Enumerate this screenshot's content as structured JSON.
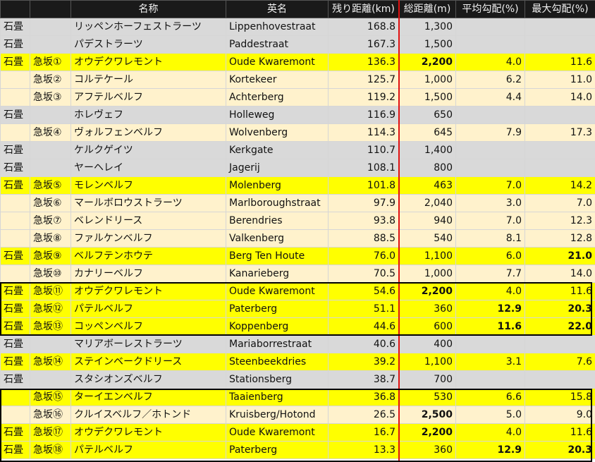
{
  "header": [
    "",
    "",
    "名称",
    "英名",
    "残り距離(km)",
    "総距離(m)",
    "平均勾配(%)",
    "最大勾配(%)"
  ],
  "rows": [
    {
      "type": "石畳",
      "climb": "",
      "name": "リッペンホーフェストラーツ",
      "en": "Lippenhovestraat",
      "km": "168.8",
      "total": "1,300",
      "avg": "",
      "max": "",
      "style": "gray",
      "bold": []
    },
    {
      "type": "石畳",
      "climb": "",
      "name": "パデストラーツ",
      "en": "Paddestraat",
      "km": "167.3",
      "total": "1,500",
      "avg": "",
      "max": "",
      "style": "gray",
      "bold": []
    },
    {
      "type": "石畳",
      "climb": "急坂①",
      "name": "オウデクワレモント",
      "en": "Oude Kwaremont",
      "km": "136.3",
      "total": "2,200",
      "avg": "4.0",
      "max": "11.6",
      "style": "yellow",
      "bold": [
        "total"
      ]
    },
    {
      "type": "",
      "climb": "急坂②",
      "name": "コルテケール",
      "en": "Kortekeer",
      "km": "125.7",
      "total": "1,000",
      "avg": "6.2",
      "max": "11.0",
      "style": "cream",
      "bold": []
    },
    {
      "type": "",
      "climb": "急坂③",
      "name": "アフテルベルフ",
      "en": "Achterberg",
      "km": "119.2",
      "total": "1,500",
      "avg": "4.4",
      "max": "14.0",
      "style": "cream",
      "bold": []
    },
    {
      "type": "石畳",
      "climb": "",
      "name": "ホレヴェフ",
      "en": "Holleweg",
      "km": "116.9",
      "total": "650",
      "avg": "",
      "max": "",
      "style": "gray",
      "bold": []
    },
    {
      "type": "",
      "climb": "急坂④",
      "name": "ヴォルフェンベルフ",
      "en": "Wolvenberg",
      "km": "114.3",
      "total": "645",
      "avg": "7.9",
      "max": "17.3",
      "style": "cream",
      "bold": []
    },
    {
      "type": "石畳",
      "climb": "",
      "name": "ケルクゲイツ",
      "en": "Kerkgate",
      "km": "110.7",
      "total": "1,400",
      "avg": "",
      "max": "",
      "style": "gray",
      "bold": []
    },
    {
      "type": "石畳",
      "climb": "",
      "name": "ヤーヘレイ",
      "en": "Jagerij",
      "km": "108.1",
      "total": "800",
      "avg": "",
      "max": "",
      "style": "gray",
      "bold": []
    },
    {
      "type": "石畳",
      "climb": "急坂⑤",
      "name": "モレンベルフ",
      "en": "Molenberg",
      "km": "101.8",
      "total": "463",
      "avg": "7.0",
      "max": "14.2",
      "style": "yellow",
      "bold": []
    },
    {
      "type": "",
      "climb": "急坂⑥",
      "name": "マールボロウストラーツ",
      "en": "Marlboroughstraat",
      "km": "97.9",
      "total": "2,040",
      "avg": "3.0",
      "max": "7.0",
      "style": "cream",
      "bold": []
    },
    {
      "type": "",
      "climb": "急坂⑦",
      "name": "ベレンドリース",
      "en": "Berendries",
      "km": "93.8",
      "total": "940",
      "avg": "7.0",
      "max": "12.3",
      "style": "cream",
      "bold": []
    },
    {
      "type": "",
      "climb": "急坂⑧",
      "name": "ファルケンベルフ",
      "en": "Valkenberg",
      "km": "88.5",
      "total": "540",
      "avg": "8.1",
      "max": "12.8",
      "style": "cream",
      "bold": []
    },
    {
      "type": "石畳",
      "climb": "急坂⑨",
      "name": "ベルフテンホウテ",
      "en": "Berg Ten Houte",
      "km": "76.0",
      "total": "1,100",
      "avg": "6.0",
      "max": "21.0",
      "style": "yellow",
      "bold": [
        "max"
      ]
    },
    {
      "type": "",
      "climb": "急坂⑩",
      "name": "カナリーベルフ",
      "en": "Kanarieberg",
      "km": "70.5",
      "total": "1,000",
      "avg": "7.7",
      "max": "14.0",
      "style": "cream",
      "bold": []
    },
    {
      "type": "石畳",
      "climb": "急坂⑪",
      "name": "オウデクワレモント",
      "en": "Oude Kwaremont",
      "km": "54.6",
      "total": "2,200",
      "avg": "4.0",
      "max": "11.6",
      "style": "yellow",
      "bold": [
        "total"
      ]
    },
    {
      "type": "石畳",
      "climb": "急坂⑫",
      "name": "パテルベルフ",
      "en": "Paterberg",
      "km": "51.1",
      "total": "360",
      "avg": "12.9",
      "max": "20.3",
      "style": "yellow",
      "bold": [
        "avg",
        "max"
      ]
    },
    {
      "type": "石畳",
      "climb": "急坂⑬",
      "name": "コッペンベルフ",
      "en": "Koppenberg",
      "km": "44.6",
      "total": "600",
      "avg": "11.6",
      "max": "22.0",
      "style": "yellow",
      "bold": [
        "avg",
        "max"
      ]
    },
    {
      "type": "石畳",
      "climb": "",
      "name": "マリアボーレストラーツ",
      "en": "Mariaborrestraat",
      "km": "40.6",
      "total": "400",
      "avg": "",
      "max": "",
      "style": "gray",
      "bold": []
    },
    {
      "type": "石畳",
      "climb": "急坂⑭",
      "name": "ステインベークドリース",
      "en": "Steenbeekdries",
      "km": "39.2",
      "total": "1,100",
      "avg": "3.1",
      "max": "7.6",
      "style": "yellow",
      "bold": []
    },
    {
      "type": "石畳",
      "climb": "",
      "name": "スタシオンズベルフ",
      "en": "Stationsberg",
      "km": "38.7",
      "total": "700",
      "avg": "",
      "max": "",
      "style": "gray",
      "bold": []
    },
    {
      "type": "",
      "climb": "急坂⑮",
      "name": "ターイエンベルフ",
      "en": "Taaienberg",
      "km": "36.8",
      "total": "530",
      "avg": "6.6",
      "max": "15.8",
      "style": "yellow",
      "bold": []
    },
    {
      "type": "",
      "climb": "急坂⑯",
      "name": "クルイスベルフ／ホトンド",
      "en": "Kruisberg/Hotond",
      "km": "26.5",
      "total": "2,500",
      "avg": "5.0",
      "max": "9.0",
      "style": "cream",
      "bold": [
        "total"
      ]
    },
    {
      "type": "石畳",
      "climb": "急坂⑰",
      "name": "オウデクワレモント",
      "en": "Oude Kwaremont",
      "km": "16.7",
      "total": "2,200",
      "avg": "4.0",
      "max": "11.6",
      "style": "yellow",
      "bold": [
        "total"
      ]
    },
    {
      "type": "石畳",
      "climb": "急坂⑱",
      "name": "パテルベルフ",
      "en": "Paterberg",
      "km": "13.3",
      "total": "360",
      "avg": "12.9",
      "max": "20.3",
      "style": "yellow",
      "bold": [
        "avg",
        "max"
      ]
    }
  ]
}
